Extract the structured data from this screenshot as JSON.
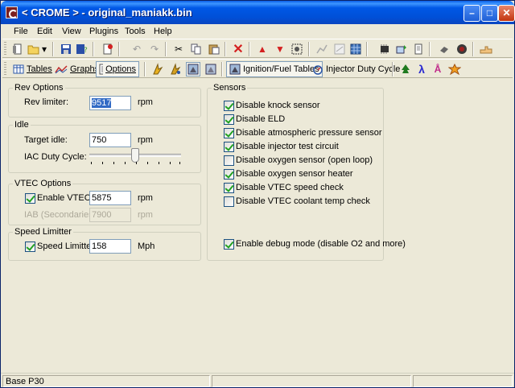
{
  "window": {
    "title": "< CROME > - original_maniakk.bin"
  },
  "menu": [
    "File",
    "Edit",
    "View",
    "Plugins",
    "Tools",
    "Help"
  ],
  "view_tabs": {
    "tables": "Tables",
    "graphs": "Graphs",
    "options": "Options",
    "ignition_fuel": "Ignition/Fuel Tables",
    "injector_duty": "Injector Duty Cycle"
  },
  "rev_options": {
    "title": "Rev Options",
    "rev_limiter_label": "Rev limiter:",
    "rev_limiter_value": "9517",
    "unit": "rpm"
  },
  "idle": {
    "title": "Idle",
    "target_idle_label": "Target idle:",
    "target_idle_value": "750",
    "unit": "rpm",
    "iac_label": "IAC Duty Cycle:",
    "iac_level_fraction": 0.5
  },
  "vtec": {
    "title": "VTEC Options",
    "enable_label": "Enable VTEC:",
    "enable_checked": true,
    "vtec_value": "5875",
    "unit": "rpm",
    "iab_label": "IAB (Secondaries):",
    "iab_value": "7900",
    "iab_unit": "rpm"
  },
  "speed": {
    "title": "Speed Limitter",
    "label": "Speed Limitter:",
    "checked": true,
    "value": "158",
    "unit": "Mph"
  },
  "sensors": {
    "title": "Sensors",
    "items": [
      {
        "label": "Disable knock sensor",
        "checked": true
      },
      {
        "label": "Disable ELD",
        "checked": true
      },
      {
        "label": "Disable atmospheric pressure sensor",
        "checked": true
      },
      {
        "label": "Disable injector test circuit",
        "checked": true
      },
      {
        "label": "Disable oxygen sensor (open loop)",
        "checked": false
      },
      {
        "label": "Disable oxygen sensor heater",
        "checked": true
      },
      {
        "label": "Disable VTEC speed check",
        "checked": true
      },
      {
        "label": "Disable VTEC coolant temp check",
        "checked": false
      }
    ],
    "debug": {
      "label": "Enable debug mode (disable O2 and more)",
      "checked": true
    }
  },
  "status": {
    "base": "Base P30"
  }
}
